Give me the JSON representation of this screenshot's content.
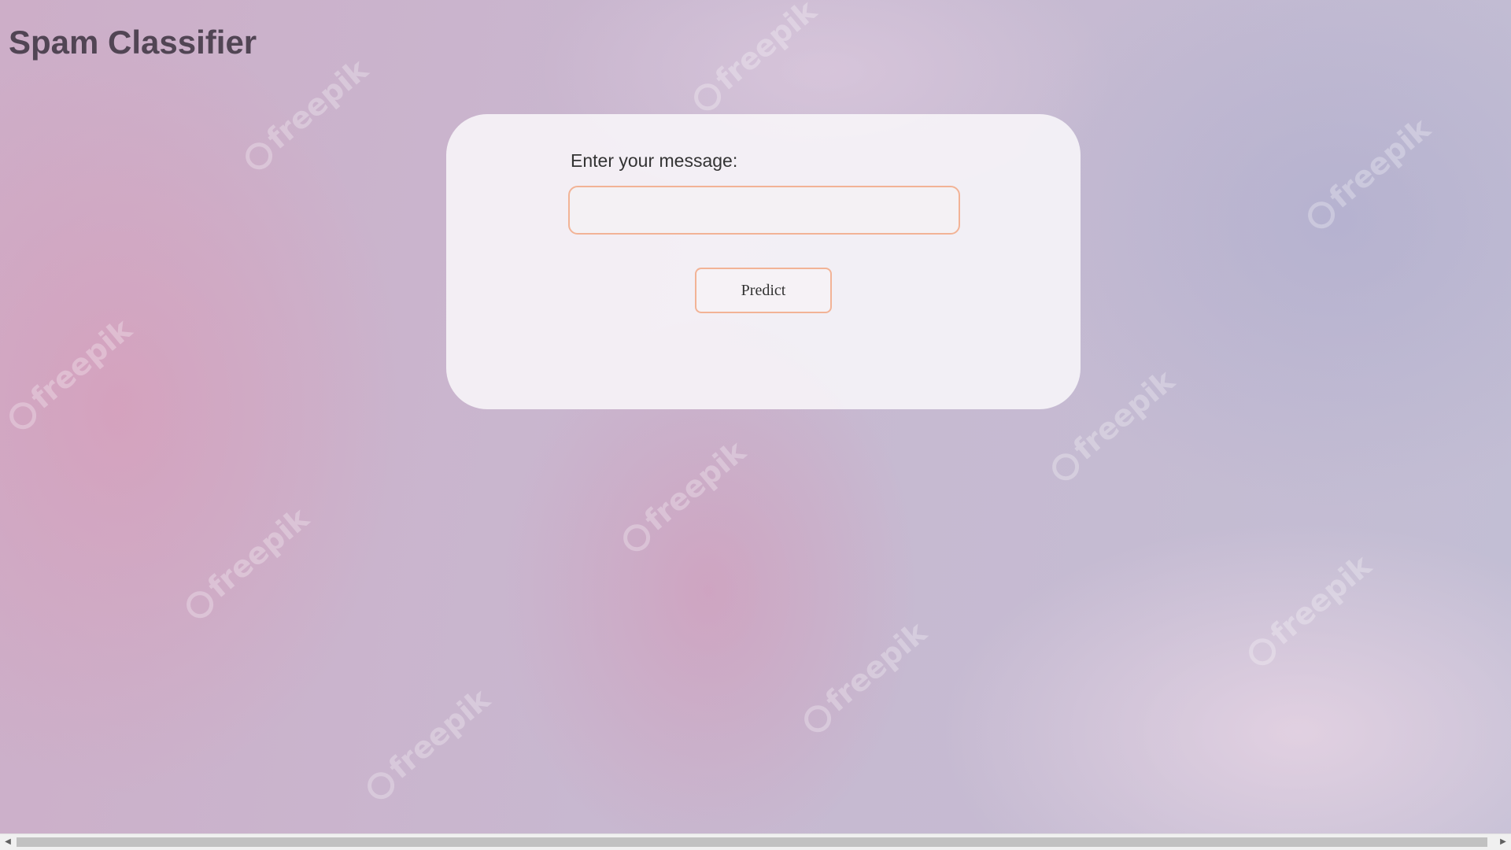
{
  "page": {
    "title": "Spam Classifier"
  },
  "form": {
    "label": "Enter your message:",
    "input_value": "",
    "input_placeholder": "",
    "button_label": "Predict"
  },
  "background": {
    "watermark_text": "freepik"
  },
  "scrollbar": {
    "left_arrow_icon": "triangle-left-icon",
    "right_arrow_icon": "triangle-right-icon"
  },
  "colors": {
    "title": "#514554",
    "accent_border": "#f2b396",
    "card_background": "#f8f6f9"
  }
}
